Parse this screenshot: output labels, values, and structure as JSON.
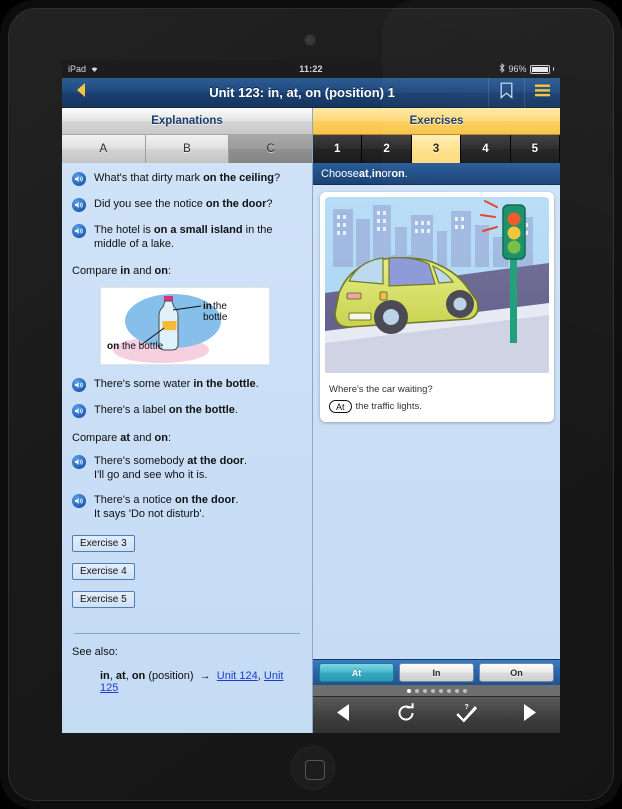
{
  "status_bar": {
    "device": "iPad",
    "wifi_icon": "wifi-icon",
    "time": "11:22",
    "bluetooth_icon": "bluetooth-icon",
    "battery_percent": "96%"
  },
  "nav_bar": {
    "back_icon": "back-triangle-icon",
    "title": "Unit 123: in, at, on (position) 1",
    "bookmark_icon": "bookmark-icon",
    "menu_icon": "hamburger-menu-icon"
  },
  "left_pane": {
    "header": "Explanations",
    "tabs": [
      {
        "label": "A",
        "active": false
      },
      {
        "label": "B",
        "active": false
      },
      {
        "label": "C",
        "active": true
      }
    ],
    "sentences": [
      {
        "icon": "speaker-icon",
        "parts": [
          {
            "t": "What's that dirty mark ",
            "b": false
          },
          {
            "t": "on the ceiling",
            "b": true
          },
          {
            "t": "?",
            "b": false
          }
        ]
      },
      {
        "icon": "speaker-icon",
        "parts": [
          {
            "t": "Did you see the notice ",
            "b": false
          },
          {
            "t": "on the door",
            "b": true
          },
          {
            "t": "?",
            "b": false
          }
        ]
      },
      {
        "icon": "speaker-icon",
        "parts": [
          {
            "t": "The hotel is ",
            "b": false
          },
          {
            "t": "on a small island",
            "b": true
          },
          {
            "t": " in the middle of a lake.",
            "b": false
          }
        ]
      }
    ],
    "compare_1": {
      "prefix": "Compare ",
      "word_a": "in",
      "mid": " and ",
      "word_b": "on",
      "suffix": ":"
    },
    "figure": {
      "name": "bottle-diagram",
      "label_in": "in the",
      "label_in2": "bottle",
      "label_on_bold": "on",
      "label_on_rest": " the bottle"
    },
    "sentences_2": [
      {
        "icon": "speaker-icon",
        "parts": [
          {
            "t": "There's some water ",
            "b": false
          },
          {
            "t": "in the bottle",
            "b": true
          },
          {
            "t": ".",
            "b": false
          }
        ]
      },
      {
        "icon": "speaker-icon",
        "parts": [
          {
            "t": "There's a label ",
            "b": false
          },
          {
            "t": "on the bottle",
            "b": true
          },
          {
            "t": ".",
            "b": false
          }
        ]
      }
    ],
    "compare_2": {
      "prefix": "Compare ",
      "word_a": "at",
      "mid": " and ",
      "word_b": "on",
      "suffix": ":"
    },
    "sentences_3": [
      {
        "icon": "speaker-icon",
        "parts": [
          {
            "t": "There's somebody ",
            "b": false
          },
          {
            "t": "at the door",
            "b": true
          },
          {
            "t": ".",
            "b": false
          },
          {
            "t": "\nI'll go and see who it is.",
            "b": false
          }
        ]
      },
      {
        "icon": "speaker-icon",
        "parts": [
          {
            "t": "There's a notice ",
            "b": false
          },
          {
            "t": "on the door",
            "b": true
          },
          {
            "t": ".",
            "b": false
          },
          {
            "t": "\nIt says 'Do not disturb'.",
            "b": false
          }
        ]
      }
    ],
    "exercise_buttons": [
      "Exercise 3",
      "Exercise 4",
      "Exercise 5"
    ],
    "see_also_label": "See also:",
    "see_also_row": {
      "b1": "in",
      "s1": ", ",
      "b2": "at",
      "s2": ", ",
      "b3": "on",
      "rest": " (position)",
      "arrow": "→",
      "links": [
        "Unit 124",
        "Unit 125"
      ],
      "link_sep": ", "
    }
  },
  "right_pane": {
    "header": "Exercises",
    "tabs": [
      {
        "label": "1",
        "active": false
      },
      {
        "label": "2",
        "active": false
      },
      {
        "label": "3",
        "active": true
      },
      {
        "label": "4",
        "active": false
      },
      {
        "label": "5",
        "active": false
      }
    ],
    "prompt": {
      "pre": "Choose ",
      "w1": "at",
      "mid1": ", ",
      "w2": "in",
      "mid2": " or ",
      "w3": "on",
      "end": "."
    },
    "card": {
      "image_name": "car-at-traffic-lights-illustration",
      "question": "Where's the car waiting?",
      "answer_value": "At",
      "answer_rest": "the traffic lights."
    },
    "answer_buttons": [
      {
        "label": "At",
        "selected": true
      },
      {
        "label": "In",
        "selected": false
      },
      {
        "label": "On",
        "selected": false
      }
    ],
    "page_dots": {
      "count": 8,
      "active_index": 0
    },
    "toolbar": [
      {
        "name": "previous-button",
        "icon": "left-triangle-icon"
      },
      {
        "name": "reset-button",
        "icon": "refresh-circle-icon"
      },
      {
        "name": "check-answers-button",
        "icon": "check-question-icon"
      },
      {
        "name": "next-button",
        "icon": "right-triangle-icon"
      }
    ]
  },
  "colors": {
    "nav_blue": "#1f4a80",
    "gold": "#ffd878",
    "panel_blue": "#cfe2f8",
    "selected_teal": "#35a9c1",
    "link_blue": "#1a3fd0"
  }
}
